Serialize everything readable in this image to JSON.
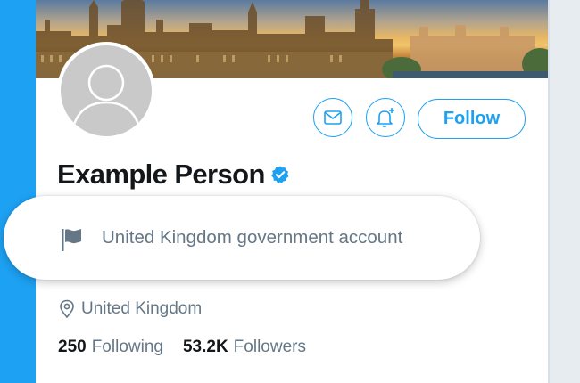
{
  "profile": {
    "display_name": "Example Person",
    "location": "United Kingdom",
    "following_count": "250",
    "following_label": "Following",
    "followers_count": "53.2K",
    "followers_label": "Followers"
  },
  "label": {
    "text": "United Kingdom government account"
  },
  "actions": {
    "follow_label": "Follow"
  },
  "icons": {
    "message": "envelope-icon",
    "notify": "bell-plus-icon",
    "verified": "verified-badge-icon",
    "label": "flag-icon",
    "location": "map-pin-icon"
  },
  "colors": {
    "accent": "#1da1f2",
    "text_primary": "#14171a",
    "text_secondary": "#657786"
  }
}
